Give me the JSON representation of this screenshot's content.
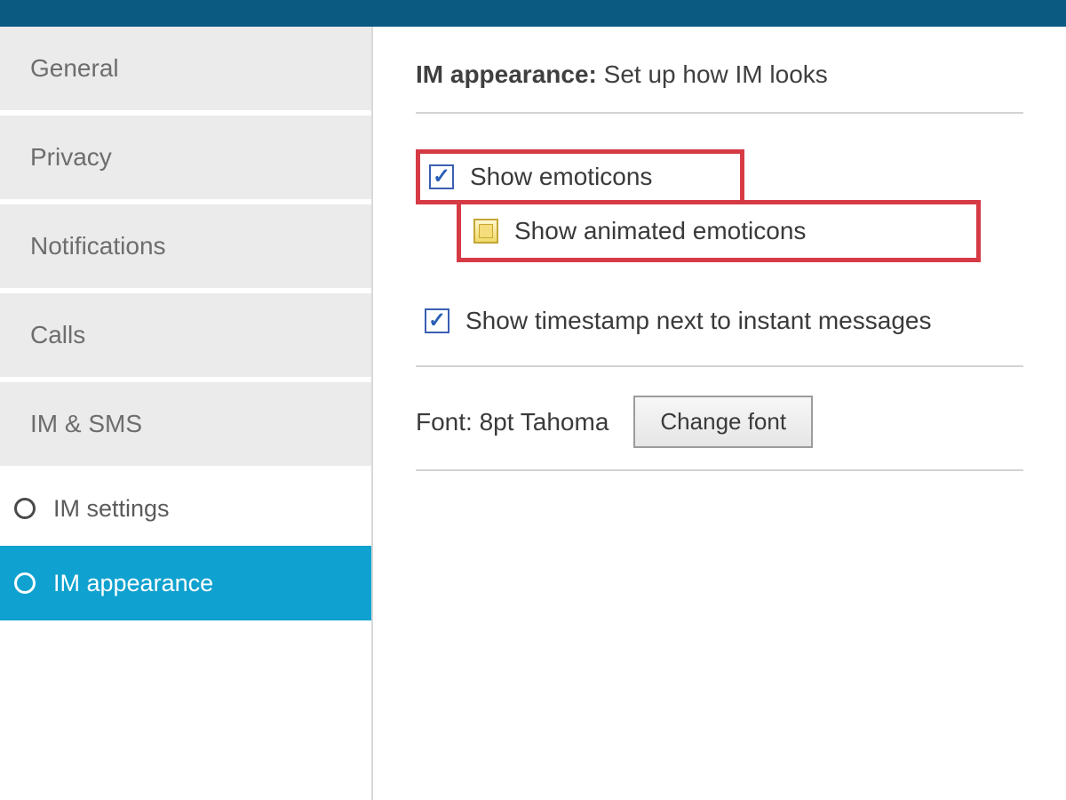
{
  "sidebar": {
    "items": [
      {
        "label": "General"
      },
      {
        "label": "Privacy"
      },
      {
        "label": "Notifications"
      },
      {
        "label": "Calls"
      },
      {
        "label": "IM & SMS"
      }
    ],
    "subitems": [
      {
        "label": "IM settings"
      },
      {
        "label": "IM appearance"
      }
    ]
  },
  "main": {
    "header_title": "IM appearance:",
    "header_desc": " Set up how IM looks",
    "show_emoticons_label": "Show emoticons",
    "show_animated_emoticons_label": "Show animated emoticons",
    "show_timestamp_label": "Show timestamp next to instant messages",
    "font_prefix": "Font: ",
    "font_value": "8pt Tahoma",
    "change_font_button": "Change font"
  }
}
